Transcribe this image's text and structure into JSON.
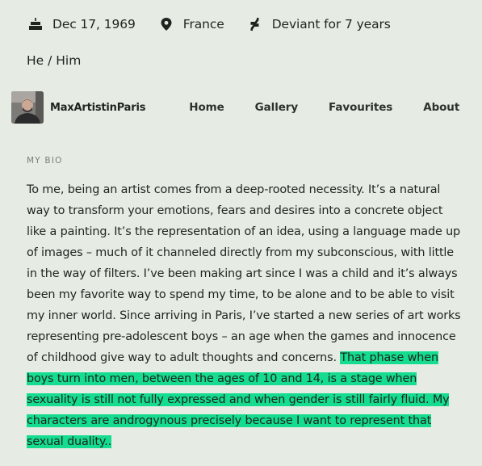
{
  "profile_meta": {
    "birthday": {
      "icon": "birthday-cake-icon",
      "text": "Dec 17, 1969"
    },
    "location": {
      "icon": "location-pin-icon",
      "text": "France"
    },
    "membership": {
      "icon": "deviantart-logo-icon",
      "text": "Deviant for 7 years"
    },
    "pronouns": "He / Him"
  },
  "nav": {
    "username": "MaxArtistinParis",
    "tabs": [
      {
        "label": "Home"
      },
      {
        "label": "Gallery"
      },
      {
        "label": "Favourites"
      },
      {
        "label": "About"
      }
    ]
  },
  "bio": {
    "heading": "MY BIO",
    "text_plain": "To me, being an artist comes from a deep-rooted necessity. It’s a natural way to transform your emotions, fears and desires into a concrete object like a painting. It’s the representation of an idea, using a language made up of images – much of it channeled directly from my subconscious, with little in the way of filters. I’ve been making art since I was a child and it’s always been my favorite way to spend my time, to be alone and to be able to visit my inner world. Since arriving in Paris, I’ve started a new series of art works representing pre-adolescent boys – an age when the games and innocence of childhood give way to adult thoughts and concerns. ",
    "text_highlighted": "That phase when boys turn into men, between the ages of 10 and 14, is a stage when sexuality is still not fully expressed and when gender is still fairly fluid. My characters are androgynous precisely because I want to represent that sexual duality..",
    "highlight_color": "#15dc8e"
  },
  "colors": {
    "background": "#e6ebe4",
    "text": "#1f241f",
    "muted": "#7b8179"
  }
}
